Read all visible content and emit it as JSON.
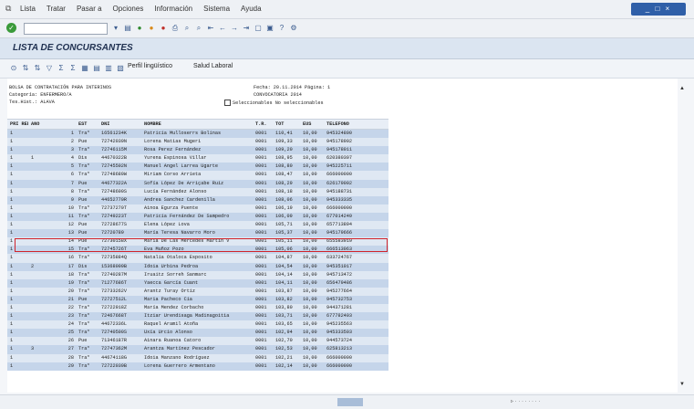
{
  "menu": [
    "Lista",
    "Tratar",
    "Pasar a",
    "Opciones",
    "Información",
    "Sistema",
    "Ayuda"
  ],
  "window_controls": "_ □ ×",
  "title": "LISTA DE CONCURSANTES",
  "toolbar": {
    "perfil": "Perfil lingüístico",
    "salud": "Salud Laboral"
  },
  "report": {
    "line1": "BOLSA DE CONTRATACIÓN PARA INTERINOS",
    "fecha": "Fecha: 20.11.2014   Página:  1",
    "line2": "Categoría: ENFERMERO/A",
    "convocatoria": "CONVOCATORIA 2014",
    "line3": "Tes.Hist.: ALAVA",
    "legend": "Seleccionables   No seleccionables"
  },
  "columns": [
    "PRI REL",
    "ANO",
    "",
    "EST",
    "DNI",
    "NOMBRE",
    "T.R.",
    "TOT",
    "EUS",
    "TELEFONO"
  ],
  "rows": [
    [
      "1",
      "",
      "1",
      "Tra*",
      "16561234K",
      "Patricia Mulloserrs Bolinas",
      "0001",
      "110,41",
      "10,00",
      "945324800"
    ],
    [
      "1",
      "",
      "2",
      "Pue",
      "72742039N",
      "Lorena Matias Mugeri",
      "0001",
      "109,33",
      "10,00",
      "945178902"
    ],
    [
      "1",
      "",
      "3",
      "Tra*",
      "72746115M",
      "Rosa Perez Fernández",
      "0001",
      "109,20",
      "10,00",
      "945178011"
    ],
    [
      "1",
      "1",
      "4",
      "Dis",
      "44670322B",
      "Yurena Espinosa Villar",
      "0001",
      "108,95",
      "10,00",
      "620380307"
    ],
    [
      "1",
      "",
      "5",
      "Tra*",
      "72745502N",
      "Manuel Angel Larrea Ugarte",
      "0001",
      "108,80",
      "10,00",
      "945225711"
    ],
    [
      "1",
      "",
      "6",
      "Tra*",
      "72748689W",
      "Miriam Corso Arrieta",
      "0001",
      "108,47",
      "10,00",
      "666000000"
    ],
    [
      "1",
      "",
      "7",
      "Pue",
      "44677322A",
      "Sofía López De Arriçabe Ruiz",
      "0001",
      "108,29",
      "10,00",
      "626179002"
    ],
    [
      "1",
      "",
      "8",
      "Tra*",
      "72748600S",
      "Lucía Fernández Alonso",
      "0001",
      "108,18",
      "10,00",
      "945188731"
    ],
    [
      "1",
      "",
      "9",
      "Pue",
      "44652770R",
      "Andrea Sanchez Cardenilla",
      "0001",
      "108,06",
      "10,00",
      "945333335"
    ],
    [
      "1",
      "",
      "10",
      "Tra*",
      "72737270T",
      "Ainoa Egurza Puente",
      "0001",
      "106,19",
      "10,00",
      "666000000"
    ],
    [
      "1",
      "",
      "11",
      "Tra*",
      "72749223T",
      "Patricia Fernández De Sampedro",
      "0001",
      "106,09",
      "10,00",
      "677014249"
    ],
    [
      "1",
      "",
      "12",
      "Pue",
      "72728677S",
      "Elena López Lova",
      "0001",
      "105,71",
      "10,00",
      "657713894"
    ],
    [
      "1",
      "",
      "13",
      "Pue",
      "72720789",
      "María Teresa Navarro Moro",
      "0001",
      "105,37",
      "10,00",
      "945179666"
    ],
    [
      "1",
      "",
      "14",
      "Pue",
      "72730158X",
      "María De Las Mercedes Martín V",
      "0001",
      "105,11",
      "10,00",
      "655583919"
    ],
    [
      "1",
      "",
      "15",
      "Tra*",
      "72745726T",
      "Eva Muñoz Pozo",
      "0001",
      "105,06",
      "10,00",
      "666513063"
    ],
    [
      "1",
      "",
      "16",
      "Tra*",
      "72735884Q",
      "Natalia Otaloca Esposito",
      "0001",
      "104,87",
      "10,00",
      "633724767"
    ],
    [
      "1",
      "2",
      "17",
      "Dis",
      "15368009B",
      "Idoia Urbina Pedroa",
      "0001",
      "104,54",
      "10,00",
      "945351017"
    ],
    [
      "1",
      "",
      "18",
      "Tra*",
      "72740287M",
      "Iruaitz Sorreh Sanmarc",
      "0001",
      "104,14",
      "10,00",
      "945713472"
    ],
    [
      "1",
      "",
      "19",
      "Tra*",
      "71277686T",
      "Yaecca García Cuant",
      "0001",
      "104,11",
      "10,00",
      "656479486"
    ],
    [
      "1",
      "",
      "20",
      "Tra*",
      "72733262V",
      "Arantz Turay Ortiz",
      "0001",
      "103,87",
      "10,00",
      "945277664"
    ],
    [
      "1",
      "",
      "21",
      "Pue",
      "72727512L",
      "Maria Pacheco Cia",
      "0001",
      "103,82",
      "10,00",
      "945732753"
    ],
    [
      "1",
      "",
      "22",
      "Tra*",
      "72722918Z",
      "María Mendez Corbacho",
      "0001",
      "103,80",
      "10,00",
      "944371281"
    ],
    [
      "1",
      "",
      "23",
      "Tra*",
      "72467668T",
      "Itziar Urendisaga Madinagoitia",
      "0001",
      "103,71",
      "10,00",
      "677782403"
    ],
    [
      "1",
      "",
      "24",
      "Tra*",
      "44672336L",
      "Raquel Aramil Atoña",
      "0001",
      "103,65",
      "10,00",
      "945235563"
    ],
    [
      "1",
      "",
      "25",
      "Tra*",
      "72740500S",
      "Uxía Urcio Alonso",
      "0001",
      "102,94",
      "10,00",
      "945333503"
    ],
    [
      "1",
      "",
      "26",
      "Pue",
      "71346187R",
      "Ainara Ruanoa Catoro",
      "0001",
      "102,70",
      "10,00",
      "944573724"
    ],
    [
      "1",
      "3",
      "27",
      "Tra*",
      "72747362M",
      "Arantza Martínez Pescador",
      "0001",
      "102,53",
      "10,00",
      "625813213"
    ],
    [
      "1",
      "",
      "28",
      "Tra*",
      "44674118G",
      "Idoia Manzano Rodríguez",
      "0001",
      "102,21",
      "10,00",
      "666000000"
    ],
    [
      "1",
      "",
      "29",
      "Tra*",
      "72722039B",
      "Lorena Guerrero Armentano",
      "0001",
      "102,14",
      "10,00",
      "666000000"
    ]
  ]
}
